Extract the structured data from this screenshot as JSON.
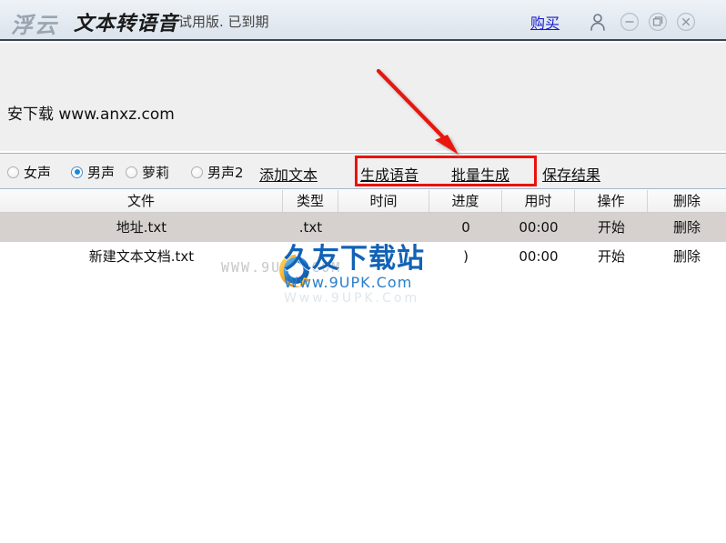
{
  "titlebar": {
    "brand": "浮云",
    "app_title": "文本转语音",
    "trial_status": "试用版. 已到期",
    "buy_label": "购买",
    "icons": {
      "user": "user-icon",
      "minimize": "minimize-icon",
      "maximize": "restore-icon",
      "close": "close-icon"
    }
  },
  "banner": {
    "site_watermark": "安下载  www.anxz.com"
  },
  "toolbar": {
    "voices": [
      {
        "label": "女声",
        "selected": false
      },
      {
        "label": "男声",
        "selected": true
      },
      {
        "label": "萝莉",
        "selected": false
      },
      {
        "label": "男声2",
        "selected": false
      }
    ],
    "actions": [
      {
        "label": "添加文本",
        "highlighted": false
      },
      {
        "label": "生成语音",
        "highlighted": true
      },
      {
        "label": "批量生成",
        "highlighted": true
      },
      {
        "label": "保存结果",
        "highlighted": false
      }
    ]
  },
  "annotation": {
    "box_color": "#e8130d",
    "arrow_color": "#e8130d"
  },
  "table": {
    "columns": [
      "文件",
      "类型",
      "时间",
      "进度",
      "用时",
      "操作",
      "删除"
    ],
    "rows": [
      {
        "file": "地址.txt",
        "type": ".txt",
        "time": "",
        "progress": "0",
        "elapsed": "00:00",
        "operation": "开始",
        "delete": "删除",
        "selected": true
      },
      {
        "file": "新建文本文档.txt",
        "type": "",
        "time": "",
        "progress": ")",
        "elapsed": "00:00",
        "operation": "开始",
        "delete": "删除",
        "selected": false
      }
    ]
  },
  "logo_watermark": {
    "faint_text": "WWW.9UPK.COM",
    "brand_cn": "久友下载站",
    "brand_url": "Www.9UPK.Com"
  }
}
